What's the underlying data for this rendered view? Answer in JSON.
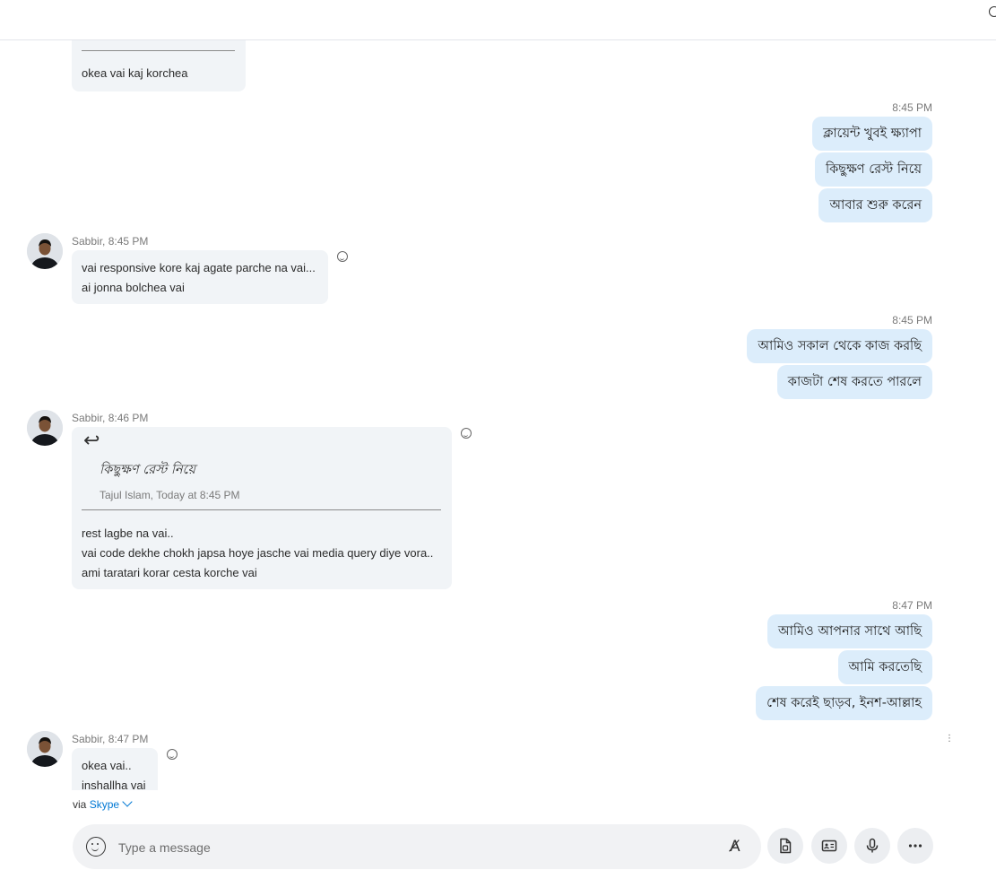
{
  "messages": {
    "m0": {
      "text": "okea vai kaj korchea"
    },
    "g1": {
      "time": "8:45 PM",
      "lines": [
        "ক্লায়েন্ট খুবই ক্ষ্যাপা",
        "কিছুক্ষণ রেস্ট নিয়ে",
        "আবার শুরু করেন"
      ]
    },
    "s1": {
      "sender": "Sabbir, 8:45 PM",
      "lines": [
        "vai responsive kore kaj agate parche na vai...",
        "ai jonna bolchea vai"
      ]
    },
    "g2": {
      "time": "8:45 PM",
      "lines": [
        "আমিও সকাল থেকে কাজ করছি",
        "কাজটা শেষ করতে পারলে"
      ]
    },
    "s2": {
      "sender": "Sabbir, 8:46 PM",
      "reply_glyph": "↩",
      "quote_text": "কিছুক্ষণ রেস্ট নিয়ে",
      "quote_meta": "Tajul Islam, Today at 8:45 PM",
      "lines": [
        "rest lagbe na vai..",
        "vai code dekhe chokh japsa hoye jasche vai media query diye vora..",
        "ami taratari korar cesta korche vai"
      ]
    },
    "g3": {
      "time": "8:47 PM",
      "lines": [
        "আমিও আপনার সাথে আছি",
        "আমি করতেছি",
        "শেষ করেই ছাড়ব, ইনশ-আল্লাহ"
      ]
    },
    "s3": {
      "sender": "Sabbir, 8:47 PM",
      "lines": [
        "okea vai..",
        "inshallha vai"
      ]
    }
  },
  "footer": {
    "via_prefix": "via",
    "via_brand": "Skype",
    "more_glyph": "⋮"
  },
  "composer": {
    "placeholder": "Type a message",
    "format_glyph": "A̸"
  },
  "colors": {
    "incoming_bubble": "#f1f4f7",
    "outgoing_bubble": "#dcedfb",
    "accent": "#0078d4"
  }
}
